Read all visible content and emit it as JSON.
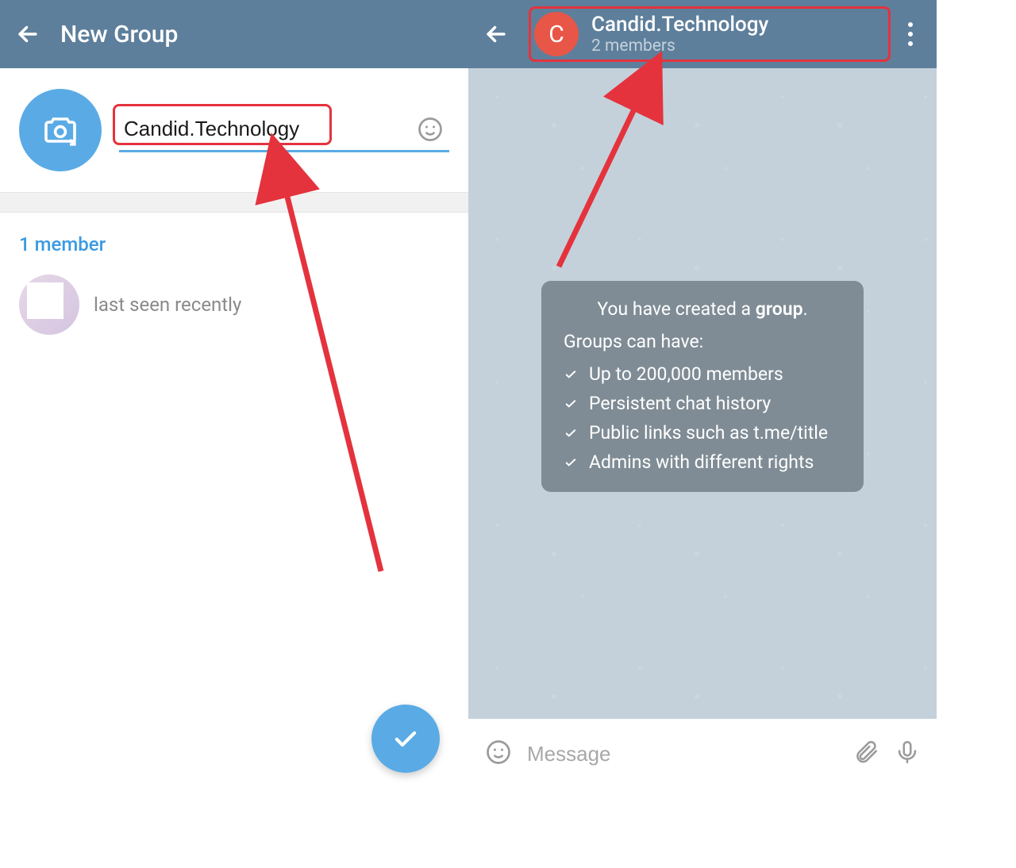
{
  "left": {
    "header_title": "New Group",
    "group_name_value": "Candid.Technology",
    "members_count_label": "1 member",
    "member": {
      "status": "last seen recently"
    }
  },
  "right": {
    "header": {
      "avatar_letter": "C",
      "title": "Candid.Technology",
      "subtitle": "2 members"
    },
    "info_card": {
      "created_prefix": "You have created a ",
      "created_bold": "group",
      "created_suffix": ".",
      "subtitle": "Groups can have:",
      "features": [
        "Up to 200,000 members",
        "Persistent chat history",
        "Public links such as t.me/title",
        "Admins with different rights"
      ]
    },
    "input_placeholder": "Message"
  }
}
